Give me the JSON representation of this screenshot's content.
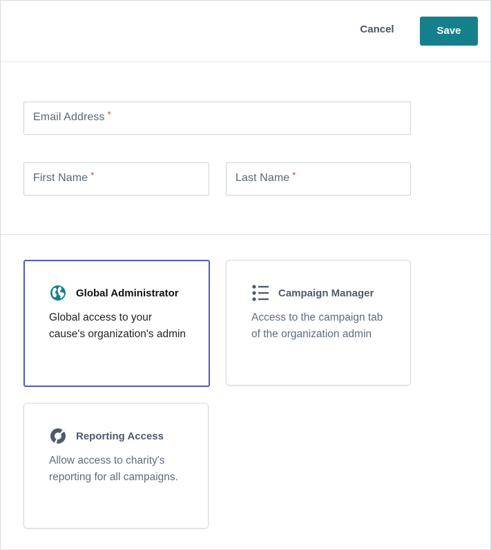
{
  "header": {
    "cancel_label": "Cancel",
    "save_label": "Save"
  },
  "form": {
    "email_label": "Email Address",
    "first_name_label": "First Name",
    "last_name_label": "Last Name",
    "required_marker": "*"
  },
  "roles": [
    {
      "title": "Global Administrator",
      "description": "Global access to your cause's organization's admin",
      "icon": "globe-icon",
      "selected": true
    },
    {
      "title": "Campaign Manager",
      "description": "Access to the campaign tab of the organization admin",
      "icon": "list-icon",
      "selected": false
    },
    {
      "title": "Reporting Access",
      "description": "Allow access to charity's reporting for all campaigns.",
      "icon": "donut-chart-icon",
      "selected": false
    }
  ],
  "colors": {
    "accent": "#15808c",
    "selected_border": "#4a5bc7",
    "required": "#d0304a"
  }
}
